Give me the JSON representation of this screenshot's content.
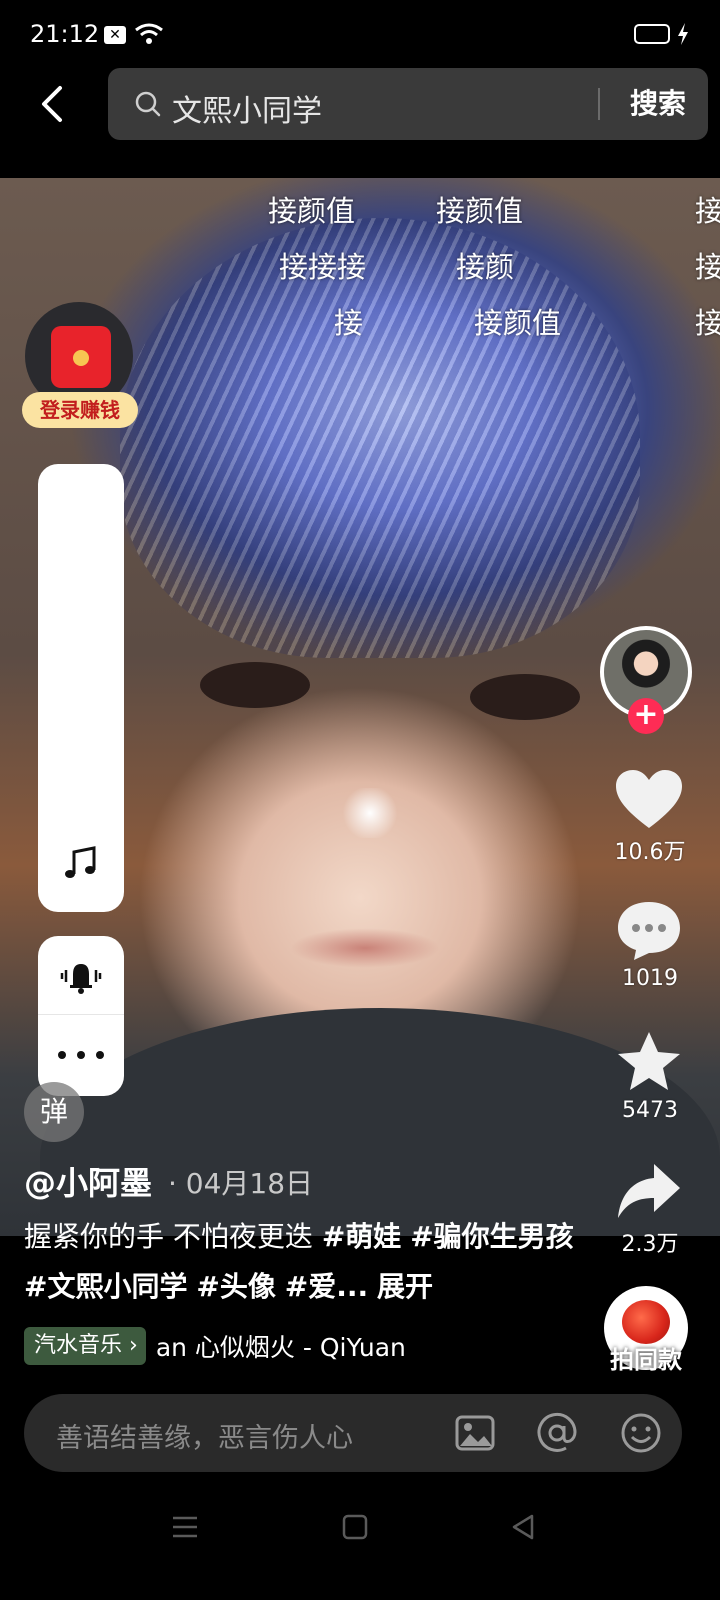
{
  "status_bar": {
    "time": "21:12"
  },
  "search": {
    "query": "文熙小同学",
    "submit_label": "搜索"
  },
  "danmaku": [
    "接颜值",
    "接颜值",
    "接",
    "接接接",
    "接颜",
    "接",
    "接",
    "接颜值",
    "接"
  ],
  "left_rail": {
    "promo_label": "登录赚钱",
    "danmu_toggle_label": "弹"
  },
  "right_rail": {
    "likes": "10.6万",
    "comments": "1019",
    "favorites": "5473",
    "shares": "2.3万",
    "remix_label": "拍同款"
  },
  "post": {
    "author": "@小阿墨",
    "date": "· 04月18日",
    "caption_text": "握紧你的手 不怕夜更迭 ",
    "tags": [
      "#萌娃",
      "#骗你生男孩",
      "#文熙小同学",
      "#头像",
      "#爱..."
    ],
    "expand_label": "展开",
    "music_badge": "汽水音乐",
    "music_title": "an 心似烟火 - QiYuan"
  },
  "comment_bar": {
    "placeholder": "善语结善缘，恶言伤人心"
  },
  "colors": {
    "follow_red": "#fe2c55",
    "promo_bg": "#fbe3a2",
    "music_badge_bg": "#3d5a3e"
  }
}
